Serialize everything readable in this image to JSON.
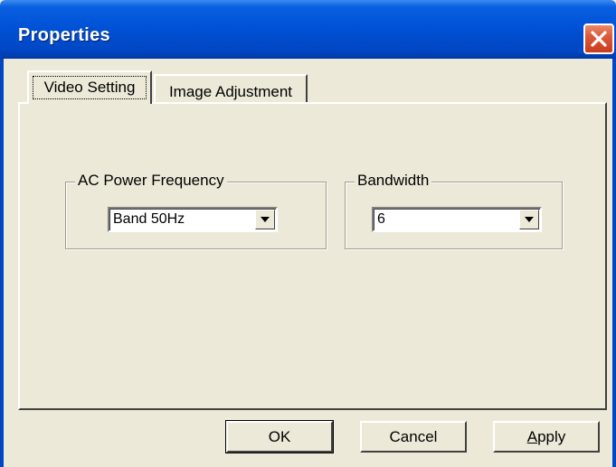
{
  "window": {
    "title": "Properties",
    "close_icon": "close-icon"
  },
  "tabs": [
    {
      "label": "Video Setting",
      "active": true
    },
    {
      "label": "Image Adjustment",
      "active": false
    }
  ],
  "groups": {
    "ac_power": {
      "label": "AC Power Frequency",
      "selected": "Band 50Hz"
    },
    "bandwidth": {
      "label": "Bandwidth",
      "selected": "6"
    }
  },
  "buttons": {
    "ok": "OK",
    "cancel": "Cancel",
    "apply_accel": "A",
    "apply_rest": "pply"
  },
  "colors": {
    "titlebar": "#0052d6",
    "close": "#dd5a3a",
    "face": "#ece9d8"
  }
}
